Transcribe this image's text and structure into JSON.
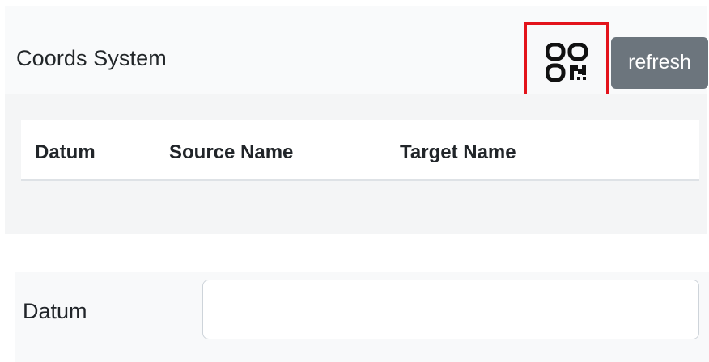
{
  "card": {
    "title": "Coords System",
    "qr_button": {
      "icon": "qr-code-icon",
      "highlight_color": "#e3131b"
    },
    "refresh_label": "refresh"
  },
  "table": {
    "columns": [
      "Datum",
      "Source Name",
      "Target Name"
    ],
    "rows": []
  },
  "form": {
    "datum": {
      "label": "Datum",
      "value": "",
      "placeholder": ""
    }
  },
  "colors": {
    "secondary_button": "#6c757d",
    "highlight_border": "#e3131b"
  }
}
